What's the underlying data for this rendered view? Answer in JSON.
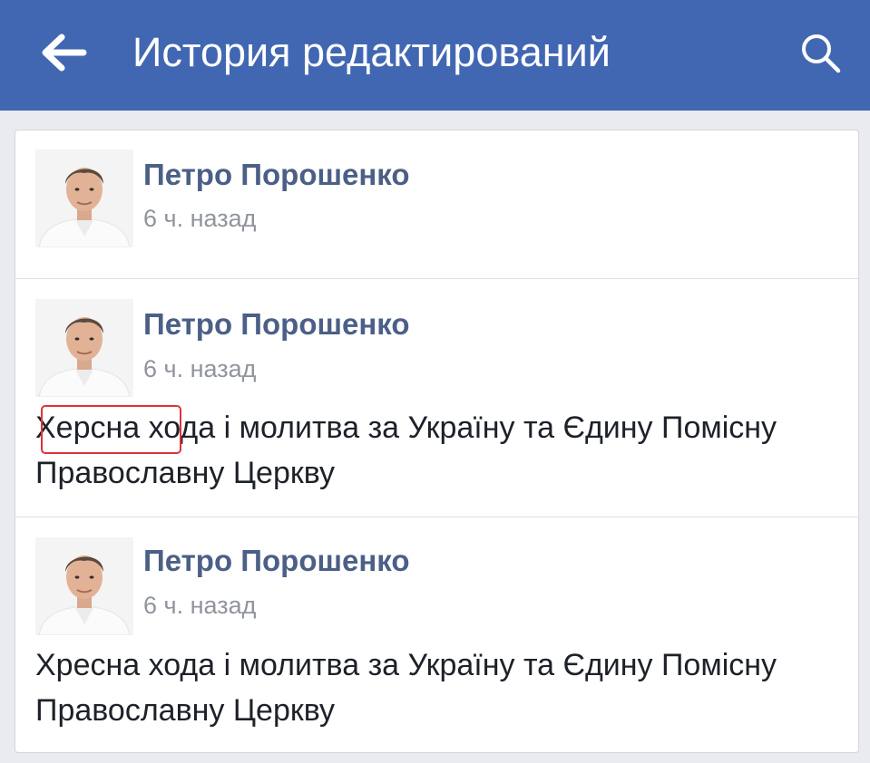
{
  "header": {
    "title": "История редактирований",
    "back_icon": "arrow-left-icon",
    "search_icon": "search-icon",
    "background_color": "#4267b2"
  },
  "revisions": [
    {
      "author": "Петро Порошенко",
      "time": "6 ч. назад",
      "text": ""
    },
    {
      "author": "Петро Порошенко",
      "time": "6 ч. назад",
      "text_highlighted": "Херсна",
      "text_rest": " хода і молитва за Україну та Єдину Помісну Православну Церкву"
    },
    {
      "author": "Петро Порошенко",
      "time": "6 ч. назад",
      "text": "Хресна хода і молитва за Україну та Єдину Помісну Православну Церкву"
    }
  ],
  "colors": {
    "author_link": "#4b5f87",
    "timestamp": "#90949c",
    "highlight_border": "#e0323a"
  }
}
